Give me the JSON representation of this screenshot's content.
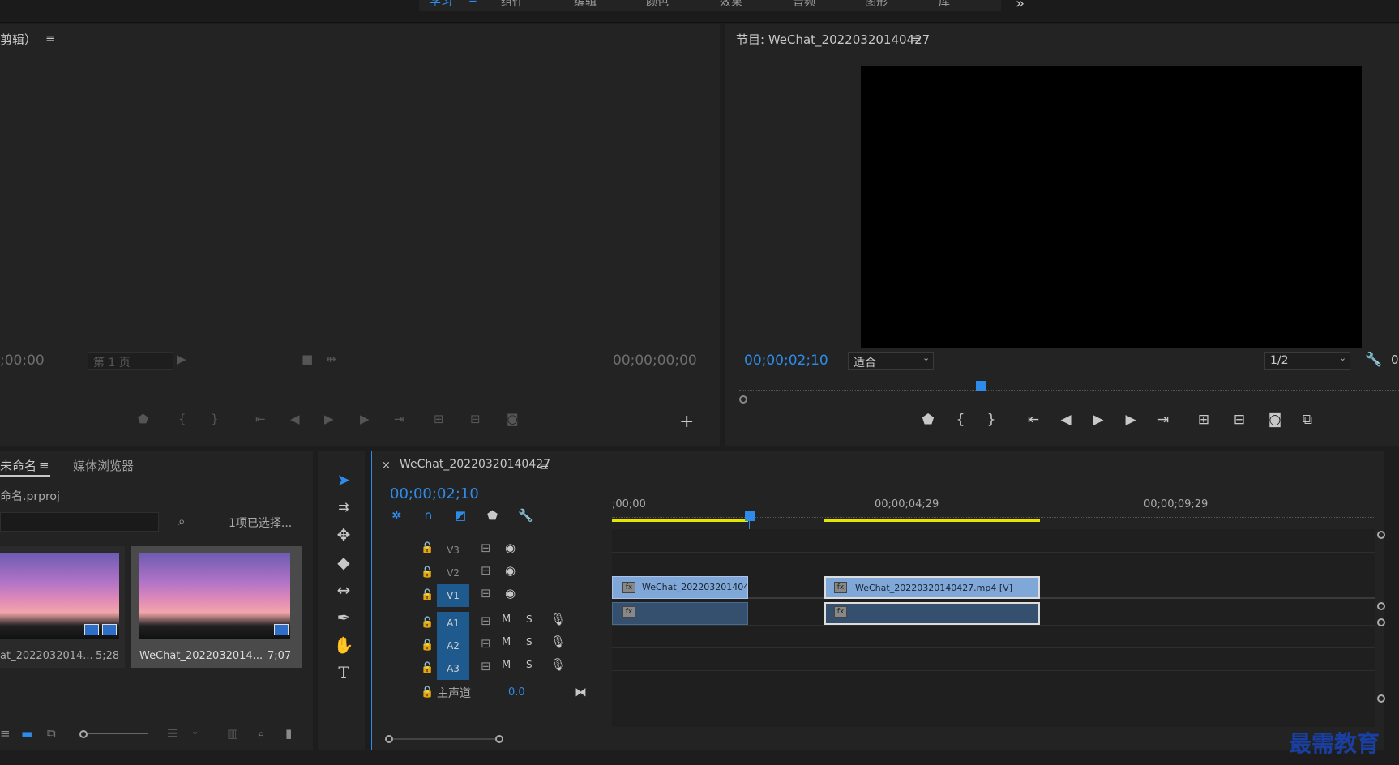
{
  "workspaces": {
    "tabs": [
      "学习",
      "组件",
      "编辑",
      "颜色",
      "效果",
      "音频",
      "图形",
      "库"
    ],
    "more_label": "»"
  },
  "source_monitor": {
    "title": "剪辑）",
    "timecode_in": ";00;00",
    "page_dropdown": "第 1 页",
    "timecode_out": "00;00;00;00",
    "add_label": "+"
  },
  "program_monitor": {
    "title": "节目: WeChat_20220320140427",
    "timecode": "00;00;02;10",
    "fit_dropdown": "适合",
    "resolution_dropdown": "1/2",
    "edge_label": "0"
  },
  "project_panel": {
    "tab_project": "未命名",
    "tab_media_browser": "媒体浏览器",
    "project_file": "命名.prproj",
    "selection_status": "1项已选择...",
    "items": [
      {
        "name": "at_2022032014...",
        "duration": "5;28"
      },
      {
        "name": "WeChat_2022032014...",
        "duration": "7;07"
      }
    ]
  },
  "timeline": {
    "sequence_name": "WeChat_20220320140427",
    "timecode": "00;00;02;10",
    "ruler": [
      ";00;00",
      "00;00;04;29",
      "00;00;09;29"
    ],
    "tracks": {
      "video": [
        "V3",
        "V2",
        "V1"
      ],
      "audio": [
        "A1",
        "A2",
        "A3"
      ],
      "mute": "M",
      "solo": "S"
    },
    "master": {
      "label": "主声道",
      "value": "0.0"
    },
    "clips": {
      "v1_first": "WeChat_2022032014042",
      "v1_second": "WeChat_20220320140427.mp4 [V]",
      "fx_label": "fx"
    }
  },
  "watermark": "最需教育",
  "colors": {
    "accent": "#2d8ceb",
    "playhead": "#2d8ceb",
    "in_out_bar": "#e6e600",
    "video_clip": "#7fa8d8",
    "audio_clip": "#35506e",
    "selected_track": "#1e5a8e"
  }
}
